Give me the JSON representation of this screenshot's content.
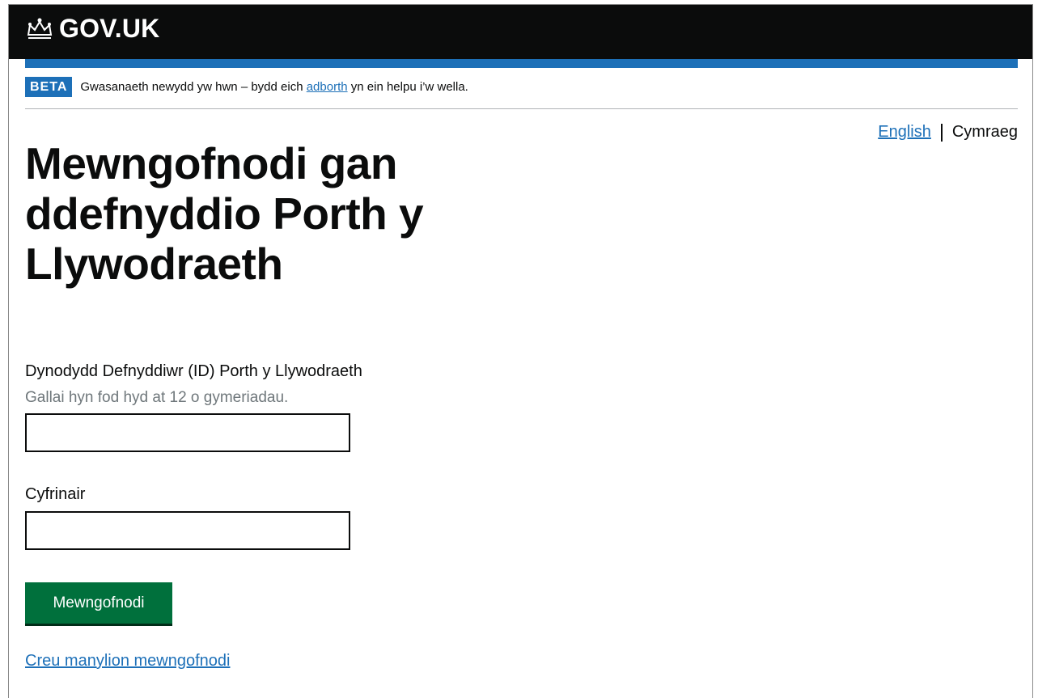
{
  "header": {
    "logo_text": "GOV.UK",
    "logo_icon": "crown-icon"
  },
  "phase_banner": {
    "tag": "BETA",
    "text_before": "Gwasanaeth newydd yw hwn – bydd eich ",
    "link": "adborth",
    "text_after": " yn ein helpu i’w wella."
  },
  "language": {
    "english": "English",
    "cymraeg": "Cymraeg"
  },
  "page": {
    "title": "Mewngofnodi gan ddefnyddio Porth y Llywodraeth"
  },
  "form": {
    "user_id_label": "Dynodydd Defnyddiwr (ID) Porth y Llywodraeth",
    "user_id_hint": "Gallai hyn fod hyd at 12 o gymeriadau.",
    "user_id_value": "",
    "password_label": "Cyfrinair",
    "password_value": "",
    "submit_label": "Mewngofnodi",
    "create_link": "Creu manylion mewngofnodi"
  },
  "colors": {
    "header_bg": "#0b0c0c",
    "brand_blue": "#1d70b8",
    "button_green": "#00703c",
    "hint_grey": "#6f777b"
  }
}
